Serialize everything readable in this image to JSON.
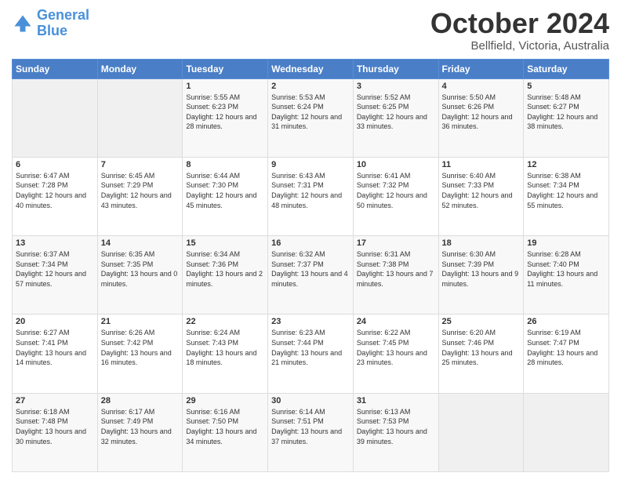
{
  "logo": {
    "line1": "General",
    "line2": "Blue"
  },
  "title": "October 2024",
  "subtitle": "Bellfield, Victoria, Australia",
  "headers": [
    "Sunday",
    "Monday",
    "Tuesday",
    "Wednesday",
    "Thursday",
    "Friday",
    "Saturday"
  ],
  "weeks": [
    [
      {
        "day": "",
        "sunrise": "",
        "sunset": "",
        "daylight": ""
      },
      {
        "day": "",
        "sunrise": "",
        "sunset": "",
        "daylight": ""
      },
      {
        "day": "1",
        "sunrise": "Sunrise: 5:55 AM",
        "sunset": "Sunset: 6:23 PM",
        "daylight": "Daylight: 12 hours and 28 minutes."
      },
      {
        "day": "2",
        "sunrise": "Sunrise: 5:53 AM",
        "sunset": "Sunset: 6:24 PM",
        "daylight": "Daylight: 12 hours and 31 minutes."
      },
      {
        "day": "3",
        "sunrise": "Sunrise: 5:52 AM",
        "sunset": "Sunset: 6:25 PM",
        "daylight": "Daylight: 12 hours and 33 minutes."
      },
      {
        "day": "4",
        "sunrise": "Sunrise: 5:50 AM",
        "sunset": "Sunset: 6:26 PM",
        "daylight": "Daylight: 12 hours and 36 minutes."
      },
      {
        "day": "5",
        "sunrise": "Sunrise: 5:48 AM",
        "sunset": "Sunset: 6:27 PM",
        "daylight": "Daylight: 12 hours and 38 minutes."
      }
    ],
    [
      {
        "day": "6",
        "sunrise": "Sunrise: 6:47 AM",
        "sunset": "Sunset: 7:28 PM",
        "daylight": "Daylight: 12 hours and 40 minutes."
      },
      {
        "day": "7",
        "sunrise": "Sunrise: 6:45 AM",
        "sunset": "Sunset: 7:29 PM",
        "daylight": "Daylight: 12 hours and 43 minutes."
      },
      {
        "day": "8",
        "sunrise": "Sunrise: 6:44 AM",
        "sunset": "Sunset: 7:30 PM",
        "daylight": "Daylight: 12 hours and 45 minutes."
      },
      {
        "day": "9",
        "sunrise": "Sunrise: 6:43 AM",
        "sunset": "Sunset: 7:31 PM",
        "daylight": "Daylight: 12 hours and 48 minutes."
      },
      {
        "day": "10",
        "sunrise": "Sunrise: 6:41 AM",
        "sunset": "Sunset: 7:32 PM",
        "daylight": "Daylight: 12 hours and 50 minutes."
      },
      {
        "day": "11",
        "sunrise": "Sunrise: 6:40 AM",
        "sunset": "Sunset: 7:33 PM",
        "daylight": "Daylight: 12 hours and 52 minutes."
      },
      {
        "day": "12",
        "sunrise": "Sunrise: 6:38 AM",
        "sunset": "Sunset: 7:34 PM",
        "daylight": "Daylight: 12 hours and 55 minutes."
      }
    ],
    [
      {
        "day": "13",
        "sunrise": "Sunrise: 6:37 AM",
        "sunset": "Sunset: 7:34 PM",
        "daylight": "Daylight: 12 hours and 57 minutes."
      },
      {
        "day": "14",
        "sunrise": "Sunrise: 6:35 AM",
        "sunset": "Sunset: 7:35 PM",
        "daylight": "Daylight: 13 hours and 0 minutes."
      },
      {
        "day": "15",
        "sunrise": "Sunrise: 6:34 AM",
        "sunset": "Sunset: 7:36 PM",
        "daylight": "Daylight: 13 hours and 2 minutes."
      },
      {
        "day": "16",
        "sunrise": "Sunrise: 6:32 AM",
        "sunset": "Sunset: 7:37 PM",
        "daylight": "Daylight: 13 hours and 4 minutes."
      },
      {
        "day": "17",
        "sunrise": "Sunrise: 6:31 AM",
        "sunset": "Sunset: 7:38 PM",
        "daylight": "Daylight: 13 hours and 7 minutes."
      },
      {
        "day": "18",
        "sunrise": "Sunrise: 6:30 AM",
        "sunset": "Sunset: 7:39 PM",
        "daylight": "Daylight: 13 hours and 9 minutes."
      },
      {
        "day": "19",
        "sunrise": "Sunrise: 6:28 AM",
        "sunset": "Sunset: 7:40 PM",
        "daylight": "Daylight: 13 hours and 11 minutes."
      }
    ],
    [
      {
        "day": "20",
        "sunrise": "Sunrise: 6:27 AM",
        "sunset": "Sunset: 7:41 PM",
        "daylight": "Daylight: 13 hours and 14 minutes."
      },
      {
        "day": "21",
        "sunrise": "Sunrise: 6:26 AM",
        "sunset": "Sunset: 7:42 PM",
        "daylight": "Daylight: 13 hours and 16 minutes."
      },
      {
        "day": "22",
        "sunrise": "Sunrise: 6:24 AM",
        "sunset": "Sunset: 7:43 PM",
        "daylight": "Daylight: 13 hours and 18 minutes."
      },
      {
        "day": "23",
        "sunrise": "Sunrise: 6:23 AM",
        "sunset": "Sunset: 7:44 PM",
        "daylight": "Daylight: 13 hours and 21 minutes."
      },
      {
        "day": "24",
        "sunrise": "Sunrise: 6:22 AM",
        "sunset": "Sunset: 7:45 PM",
        "daylight": "Daylight: 13 hours and 23 minutes."
      },
      {
        "day": "25",
        "sunrise": "Sunrise: 6:20 AM",
        "sunset": "Sunset: 7:46 PM",
        "daylight": "Daylight: 13 hours and 25 minutes."
      },
      {
        "day": "26",
        "sunrise": "Sunrise: 6:19 AM",
        "sunset": "Sunset: 7:47 PM",
        "daylight": "Daylight: 13 hours and 28 minutes."
      }
    ],
    [
      {
        "day": "27",
        "sunrise": "Sunrise: 6:18 AM",
        "sunset": "Sunset: 7:48 PM",
        "daylight": "Daylight: 13 hours and 30 minutes."
      },
      {
        "day": "28",
        "sunrise": "Sunrise: 6:17 AM",
        "sunset": "Sunset: 7:49 PM",
        "daylight": "Daylight: 13 hours and 32 minutes."
      },
      {
        "day": "29",
        "sunrise": "Sunrise: 6:16 AM",
        "sunset": "Sunset: 7:50 PM",
        "daylight": "Daylight: 13 hours and 34 minutes."
      },
      {
        "day": "30",
        "sunrise": "Sunrise: 6:14 AM",
        "sunset": "Sunset: 7:51 PM",
        "daylight": "Daylight: 13 hours and 37 minutes."
      },
      {
        "day": "31",
        "sunrise": "Sunrise: 6:13 AM",
        "sunset": "Sunset: 7:53 PM",
        "daylight": "Daylight: 13 hours and 39 minutes."
      },
      {
        "day": "",
        "sunrise": "",
        "sunset": "",
        "daylight": ""
      },
      {
        "day": "",
        "sunrise": "",
        "sunset": "",
        "daylight": ""
      }
    ]
  ]
}
